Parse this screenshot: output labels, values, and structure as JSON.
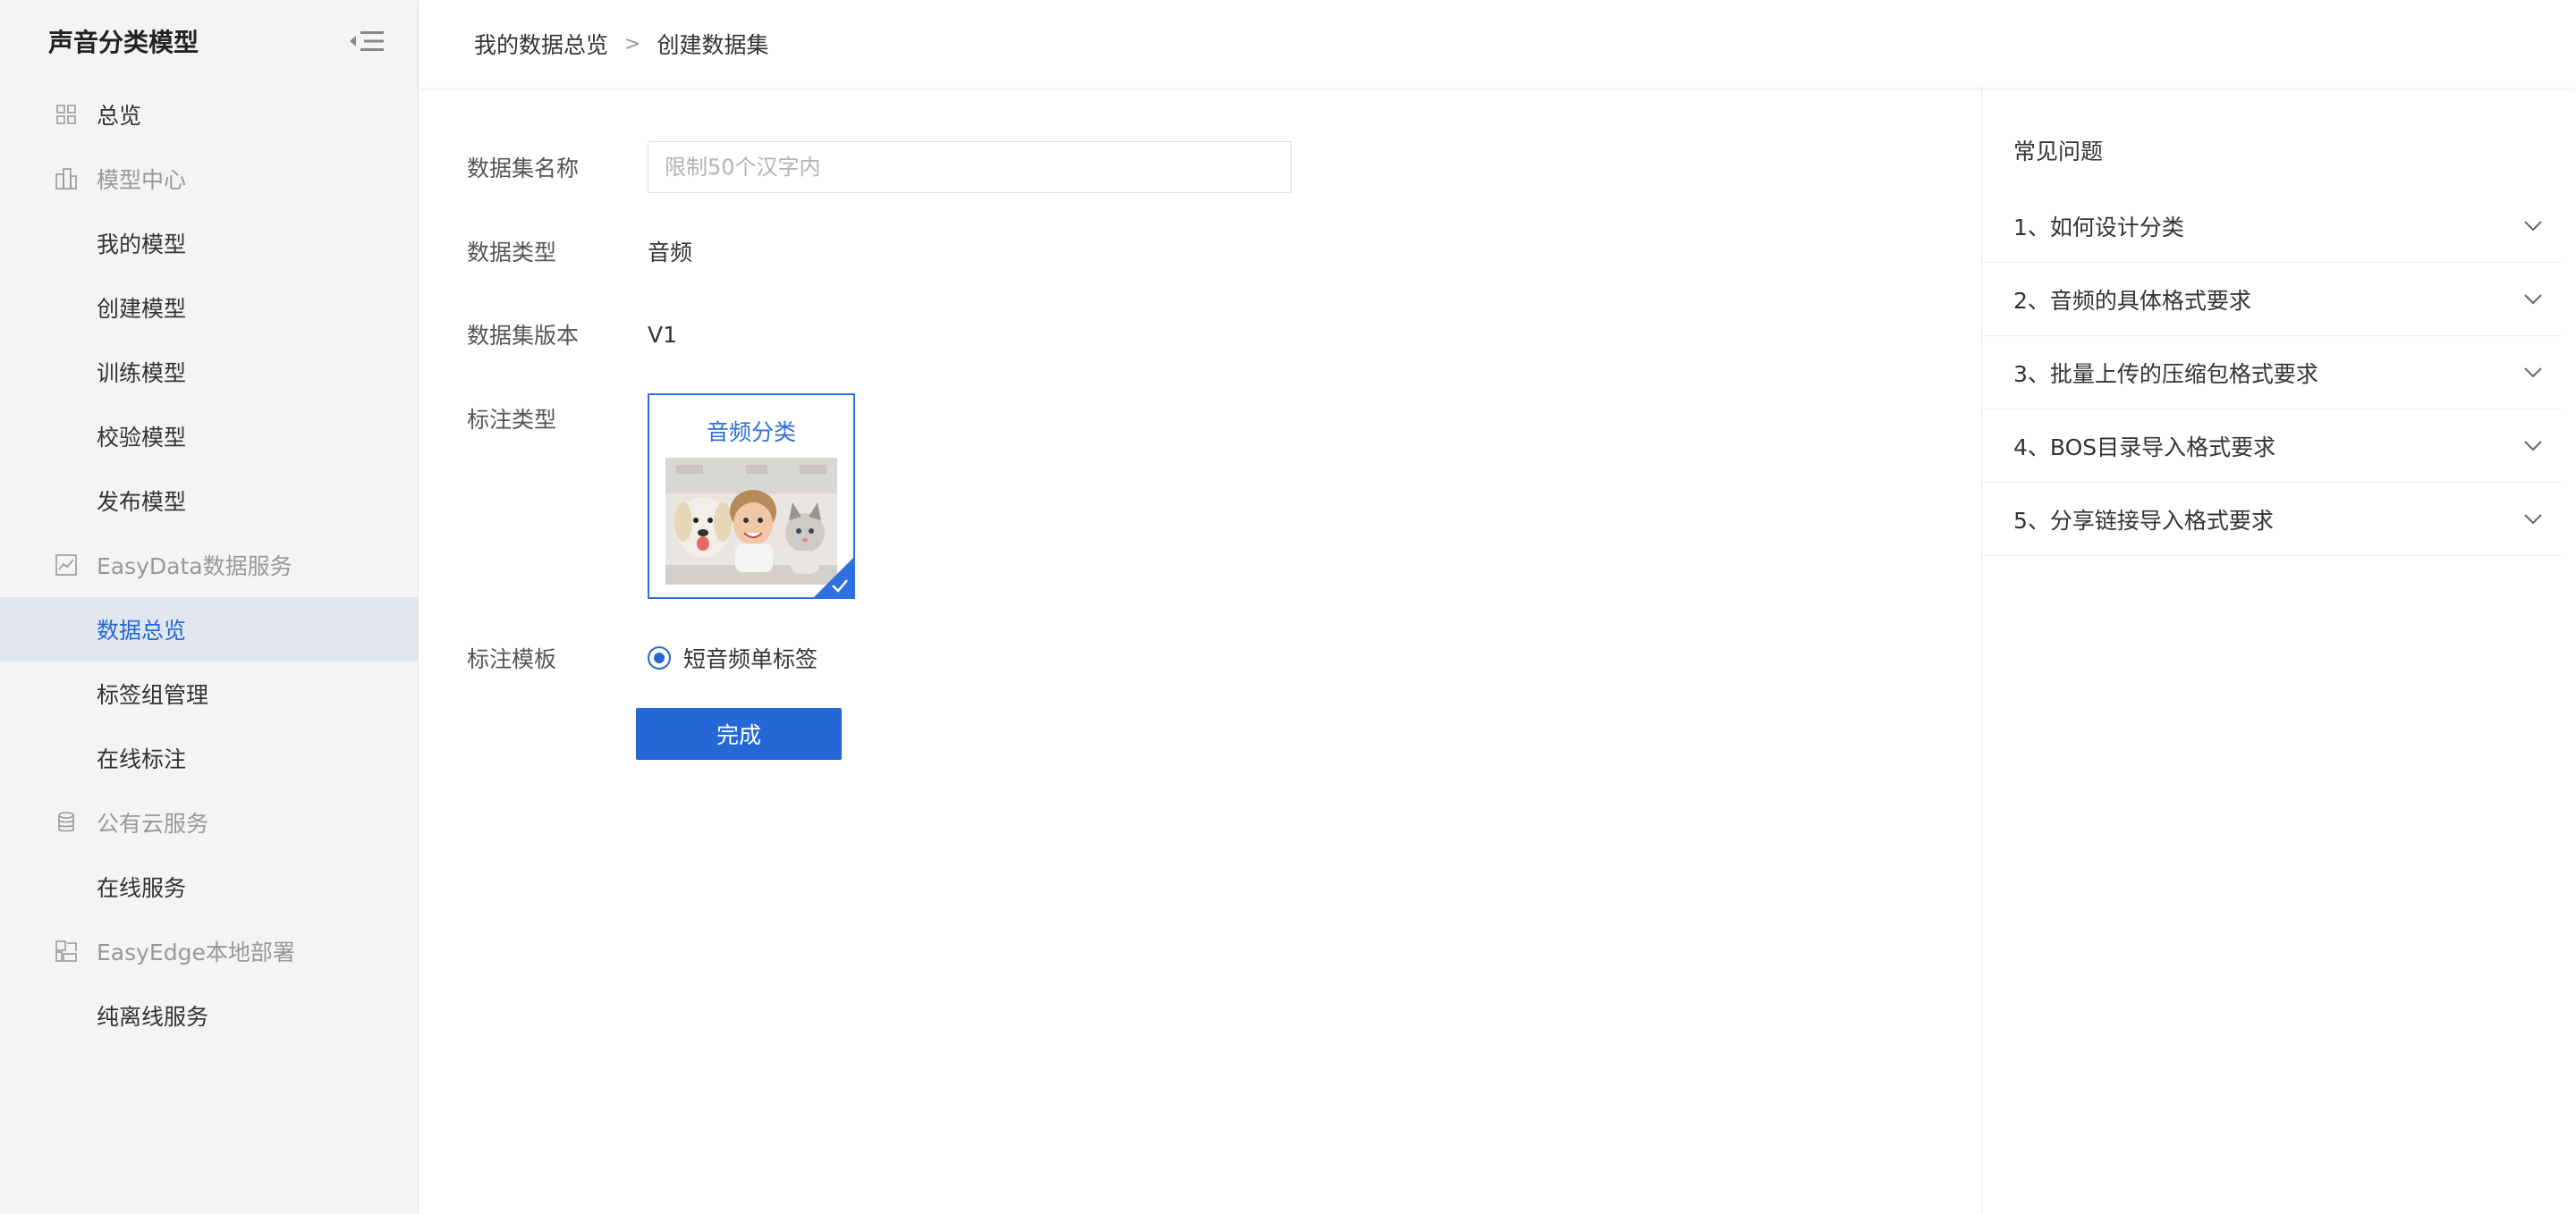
{
  "sidebar": {
    "title": "声音分类模型",
    "items": [
      {
        "label": "总览"
      },
      {
        "label": "模型中心"
      },
      {
        "label": "我的模型"
      },
      {
        "label": "创建模型"
      },
      {
        "label": "训练模型"
      },
      {
        "label": "校验模型"
      },
      {
        "label": "发布模型"
      },
      {
        "label": "EasyData数据服务"
      },
      {
        "label": "数据总览"
      },
      {
        "label": "标签组管理"
      },
      {
        "label": "在线标注"
      },
      {
        "label": "公有云服务"
      },
      {
        "label": "在线服务"
      },
      {
        "label": "EasyEdge本地部署"
      },
      {
        "label": "纯离线服务"
      }
    ]
  },
  "breadcrumb": {
    "parent": "我的数据总览",
    "separator": ">",
    "current": "创建数据集"
  },
  "form": {
    "name_label": "数据集名称",
    "name_placeholder": "限制50个汉字内",
    "name_value": "",
    "type_label": "数据类型",
    "type_value": "音频",
    "version_label": "数据集版本",
    "version_value": "V1",
    "annotation_type_label": "标注类型",
    "annotation_type_option": "音频分类",
    "template_label": "标注模板",
    "template_option": "短音频单标签",
    "submit_label": "完成"
  },
  "faq": {
    "title": "常见问题",
    "items": [
      {
        "label": "1、如何设计分类"
      },
      {
        "label": "2、音频的具体格式要求"
      },
      {
        "label": "3、批量上传的压缩包格式要求"
      },
      {
        "label": "4、BOS目录导入格式要求"
      },
      {
        "label": "5、分享链接导入格式要求"
      }
    ]
  },
  "colors": {
    "accent": "#2468d6",
    "sidebar_bg": "#f4f4f4",
    "active_bg": "#e2e6ef"
  }
}
